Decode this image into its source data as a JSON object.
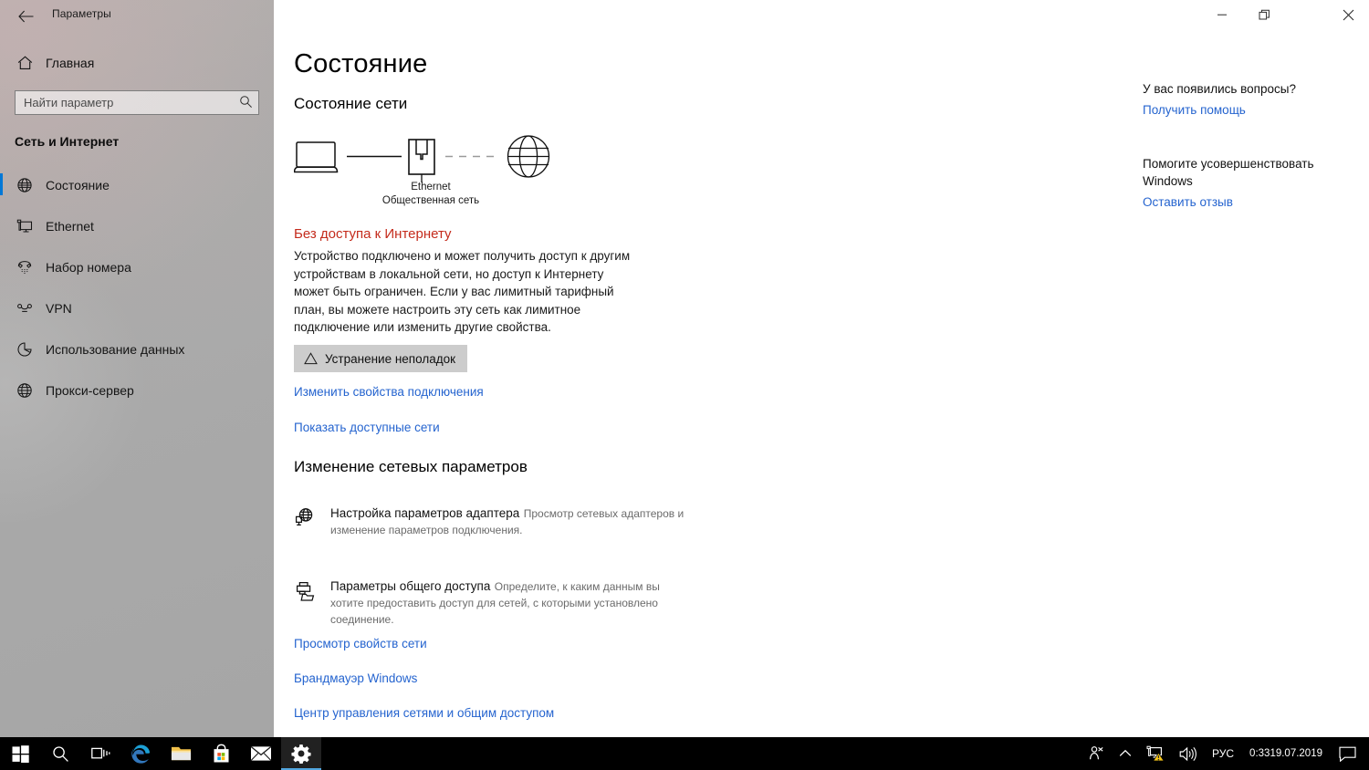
{
  "window": {
    "app_title": "Параметры",
    "back_icon": "back-arrow-icon",
    "controls": {
      "minimize": "minimize-icon",
      "maximize": "restore-icon",
      "close": "close-icon"
    }
  },
  "sidebar": {
    "home": {
      "label": "Главная",
      "icon": "home-icon"
    },
    "search": {
      "placeholder": "Найти параметр",
      "value": "",
      "icon": "search-icon"
    },
    "group_title": "Сеть и Интернет",
    "items": [
      {
        "label": "Состояние",
        "icon": "globe-status-icon",
        "active": true
      },
      {
        "label": "Ethernet",
        "icon": "ethernet-icon",
        "active": false
      },
      {
        "label": "Набор номера",
        "icon": "dialup-phone-icon",
        "active": false
      },
      {
        "label": "VPN",
        "icon": "vpn-icon",
        "active": false
      },
      {
        "label": "Использование данных",
        "icon": "data-usage-pie-icon",
        "active": false
      },
      {
        "label": "Прокси-сервер",
        "icon": "proxy-globe-icon",
        "active": false
      }
    ],
    "accent_color": "#0078d7"
  },
  "main": {
    "page_title": "Состояние",
    "section_network_status": "Состояние сети",
    "diagram": {
      "device_icon": "laptop-icon",
      "adapter_icon": "ethernet-port-icon",
      "internet_icon": "globe-icon",
      "link_device_to_adapter": "solid",
      "link_adapter_to_internet": "dashed",
      "adapter_label": "Ethernet",
      "network_profile": "Общественная сеть"
    },
    "status": {
      "heading": "Без доступа к Интернету",
      "heading_color": "#c42b1c",
      "description": "Устройство подключено и может получить доступ к другим устройствам в локальной сети, но доступ к Интернету может быть ограничен. Если у вас лимитный тарифный план, вы можете настроить эту сеть как лимитное подключение или изменить другие свойства."
    },
    "troubleshoot_button": {
      "label": "Устранение неполадок",
      "icon": "warning-triangle-icon"
    },
    "links_top": [
      "Изменить свойства подключения",
      "Показать доступные сети"
    ],
    "section_change_params": "Изменение сетевых параметров",
    "settings_items": [
      {
        "title": "Настройка параметров адаптера",
        "desc": "Просмотр сетевых адаптеров и изменение параметров подключения.",
        "icon": "network-adapter-icon"
      },
      {
        "title": "Параметры общего доступа",
        "desc": "Определите, к каким данным вы хотите предоставить доступ для сетей, с которыми установлено соединение.",
        "icon": "sharing-printer-folder-icon"
      }
    ],
    "links_bottom": [
      "Просмотр свойств сети",
      "Брандмауэр Windows",
      "Центр управления сетями и общим доступом"
    ],
    "link_color": "#2564cf"
  },
  "help": {
    "question_heading": "У вас появились вопросы?",
    "question_link": "Получить помощь",
    "improve_heading": "Помогите усовершенствовать Windows",
    "improve_link": "Оставить отзыв"
  },
  "taskbar": {
    "buttons": [
      {
        "name": "start",
        "icon": "windows-logo-icon"
      },
      {
        "name": "search",
        "icon": "search-icon"
      },
      {
        "name": "task-view",
        "icon": "task-view-icon"
      },
      {
        "name": "edge",
        "icon": "edge-browser-icon"
      },
      {
        "name": "file-explorer",
        "icon": "folder-icon"
      },
      {
        "name": "store",
        "icon": "store-bag-icon"
      },
      {
        "name": "mail",
        "icon": "mail-envelope-icon"
      },
      {
        "name": "settings",
        "icon": "gear-icon",
        "active": true
      }
    ],
    "tray": {
      "people_icon": "people-icon",
      "chevron_icon": "chevron-up-icon",
      "network_icon": "network-warning-icon",
      "volume_icon": "speaker-icon",
      "language": "РУС",
      "time": "0:33",
      "date": "19.07.2019",
      "action_center_icon": "action-center-icon"
    }
  }
}
